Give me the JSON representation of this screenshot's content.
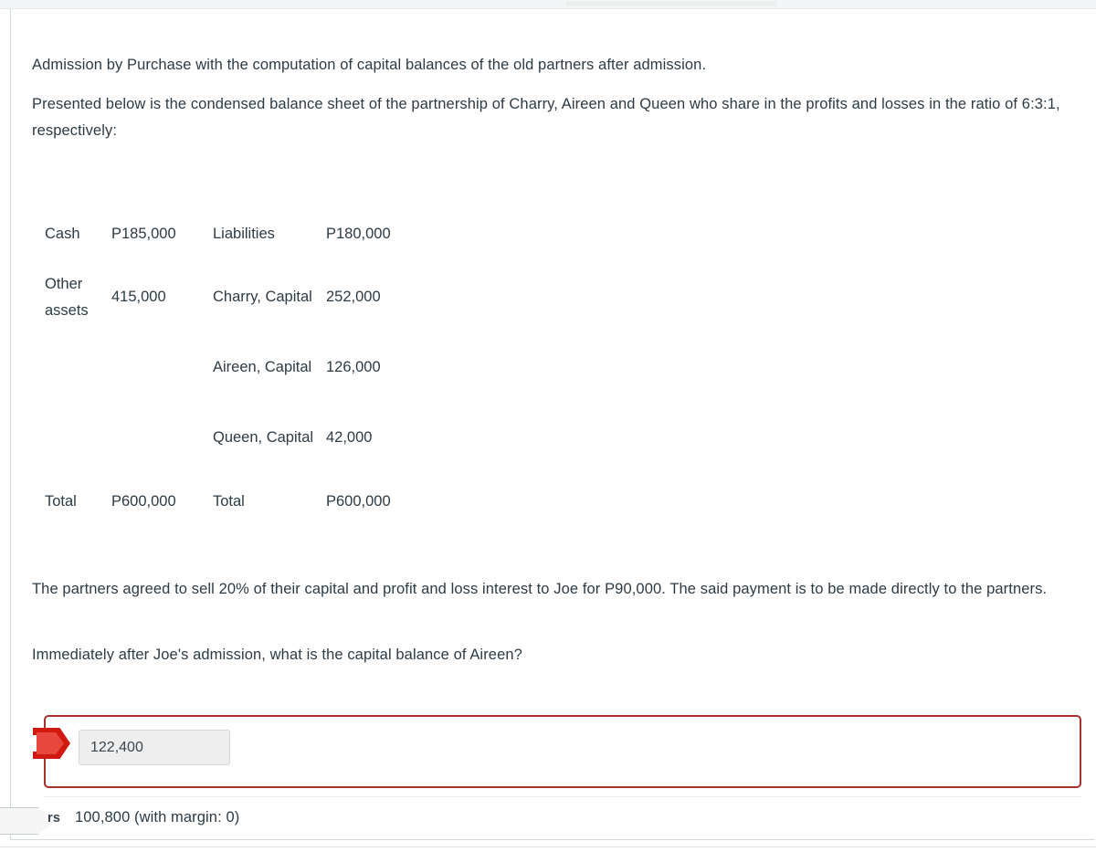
{
  "question": {
    "intro_line": "Admission by Purchase with the computation of capital balances of the old partners after admission.",
    "prompt_line": " Presented below is the condensed balance sheet of the partnership of Charry, Aireen and Queen who share in the profits and losses in the ratio of 6:3:1, respectively:",
    "detail_line": "The partners agreed to sell 20% of their capital and profit and loss interest to Joe for P90,000. The said payment is to be made directly to the partners.",
    "ask_line": "Immediately after Joe's admission, what is the capital balance of Aireen?"
  },
  "balance_sheet": {
    "rows": [
      {
        "asset_label": "Cash",
        "asset_value": "P185,000",
        "equity_label": "Liabilities",
        "equity_value": "P180,000"
      },
      {
        "asset_label": "Other assets",
        "asset_value": "415,000",
        "equity_label": "Charry, Capital",
        "equity_value": "252,000"
      },
      {
        "asset_label": "",
        "asset_value": "",
        "equity_label": "Aireen, Capital",
        "equity_value": "126,000"
      },
      {
        "asset_label": "",
        "asset_value": "",
        "equity_label": "Queen, Capital",
        "equity_value": "42,000"
      },
      {
        "asset_label": "Total",
        "asset_value": "P600,000",
        "equity_label": "Total",
        "equity_value": "P600,000"
      }
    ]
  },
  "answer": {
    "submitted_value": "122,400",
    "input_placeholder": "",
    "correct_label": "rs",
    "correct_answer": "100,800 (with margin: 0)",
    "incorrect_border_color": "#a5332b",
    "marker_color": "#d01a11"
  }
}
